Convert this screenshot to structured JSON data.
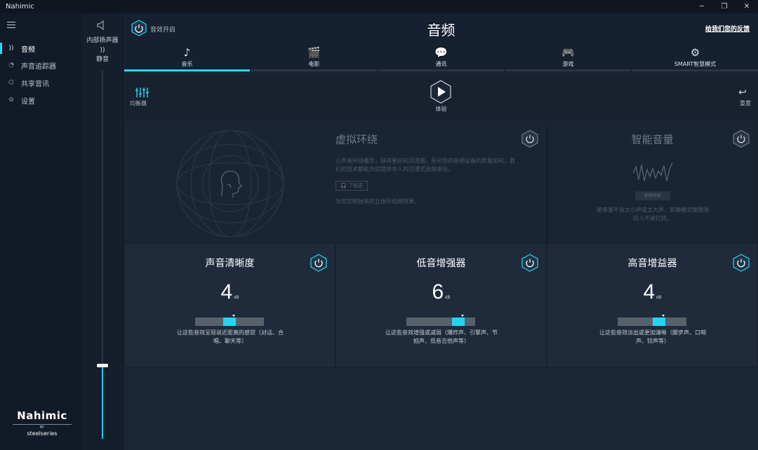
{
  "window": {
    "title": "Nahimic",
    "min_icon": "minimize-icon",
    "max_icon": "maximize-icon",
    "close_icon": "close-icon"
  },
  "sidebar": {
    "menu_icon": "hamburger-icon",
    "items": [
      {
        "label": "音频",
        "icon": "audio-wave-icon",
        "active": true
      },
      {
        "label": "声音追踪器",
        "icon": "radar-icon",
        "active": false
      },
      {
        "label": "共享音讯",
        "icon": "share-icon",
        "active": false
      },
      {
        "label": "设置",
        "icon": "gear-icon",
        "active": false
      }
    ],
    "logo": {
      "brand": "Nahimic",
      "by": "BY",
      "partner": "steelseries"
    }
  },
  "volume": {
    "device_label": "内部扬声器",
    "mute_label": "静音",
    "level": 0.2
  },
  "header": {
    "effects_label": "音效开启",
    "title": "音频",
    "feedback_link": "给我们您的反馈"
  },
  "tabs": [
    {
      "label": "音乐",
      "icon": "music-note-icon",
      "active": true
    },
    {
      "label": "电影",
      "icon": "clapperboard-icon",
      "active": false
    },
    {
      "label": "通讯",
      "icon": "chat-icon",
      "active": false
    },
    {
      "label": "游戏",
      "icon": "gamepad-icon",
      "active": false
    },
    {
      "label": "SMART智慧模式",
      "icon": "smart-gear-icon",
      "active": false
    }
  ],
  "toolbar": {
    "equalizer_label": "均衡器",
    "experience_label": "体验",
    "reset_label": "重置"
  },
  "virtual_surround": {
    "title": "虚拟环绕",
    "desc": "让声音环绕着您，获得更好的沉浸感。无论您的音频设备的质量如何，我们的技术都能为您提供令人的沉浸式音效体验。",
    "button": "了解更",
    "note": "为您定制独有的立体环绕频效果。",
    "enabled": false
  },
  "smart_volume": {
    "title": "智能音量",
    "button": "影响关联",
    "desc": "使音量不会太小声或太大声，安静模式使周围的人不被打扰。",
    "enabled": false
  },
  "effects": [
    {
      "title": "声音清晰度",
      "value": "4",
      "unit": "dB",
      "level": 0.5,
      "desc": "让这些音效呈现说近距离的感觉（对话、合唱、聊天等）",
      "enabled": true
    },
    {
      "title": "低音增强器",
      "value": "6",
      "unit": "dB",
      "level": 0.75,
      "desc": "让这些音效增强或减弱（爆炸声、引擎声、节拍声、低音吉他声等）",
      "enabled": true
    },
    {
      "title": "高音增益器",
      "value": "4",
      "unit": "dB",
      "level": 0.6,
      "desc": "让这些音效淡出或更加清晰（脚步声、口哨声、铰声等）",
      "enabled": true
    }
  ],
  "colors": {
    "accent": "#2ed3f0",
    "background": "#1b2636",
    "sidebar": "#111a26"
  }
}
